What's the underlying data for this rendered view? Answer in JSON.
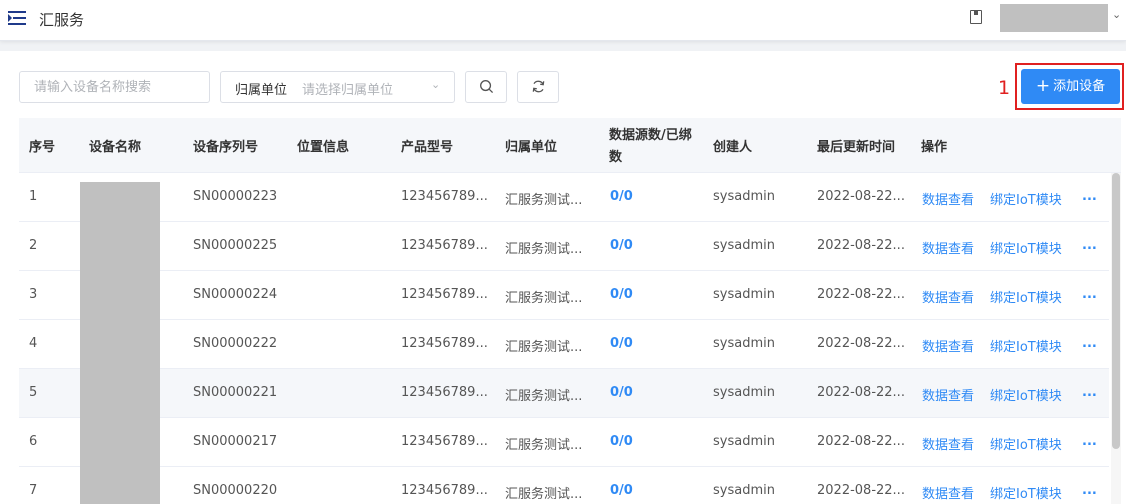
{
  "header": {
    "title": "汇服务",
    "menu_icon": "menu-fold-icon",
    "doc_icon": "document-icon",
    "user_menu_icon": "chevron-down-icon"
  },
  "toolbar": {
    "search_placeholder": "请输入设备名称搜索",
    "filter_label": "归属单位",
    "filter_placeholder": "请选择归属单位",
    "search_icon": "search-icon",
    "refresh_icon": "refresh-icon",
    "add_button_label": "添加设备",
    "add_button_icon": "plus-icon",
    "annotation_number": "1",
    "accent_color": "#2f8af5",
    "annotation_color": "#e02020"
  },
  "table": {
    "columns": [
      "序号",
      "设备名称",
      "设备序列号",
      "位置信息",
      "产品型号",
      "归属单位",
      "数据源数/已绑数",
      "创建人",
      "最后更新时间",
      "操作"
    ],
    "rows": [
      {
        "index": "1",
        "serial": "SN00000223",
        "model": "123456789...",
        "unit": "汇服务测试...",
        "count": "0/0",
        "creator": "sysadmin",
        "updated": "2022-08-22...",
        "action1": "数据查看",
        "action2": "绑定IoT模块",
        "more": "..."
      },
      {
        "index": "2",
        "serial": "SN00000225",
        "model": "123456789...",
        "unit": "汇服务测试...",
        "count": "0/0",
        "creator": "sysadmin",
        "updated": "2022-08-22...",
        "action1": "数据查看",
        "action2": "绑定IoT模块",
        "more": "..."
      },
      {
        "index": "3",
        "serial": "SN00000224",
        "model": "123456789...",
        "unit": "汇服务测试...",
        "count": "0/0",
        "creator": "sysadmin",
        "updated": "2022-08-22...",
        "action1": "数据查看",
        "action2": "绑定IoT模块",
        "more": "..."
      },
      {
        "index": "4",
        "serial": "SN00000222",
        "model": "123456789...",
        "unit": "汇服务测试...",
        "count": "0/0",
        "creator": "sysadmin",
        "updated": "2022-08-22...",
        "action1": "数据查看",
        "action2": "绑定IoT模块",
        "more": "..."
      },
      {
        "index": "5",
        "serial": "SN00000221",
        "model": "123456789...",
        "unit": "汇服务测试...",
        "count": "0/0",
        "creator": "sysadmin",
        "updated": "2022-08-22...",
        "action1": "数据查看",
        "action2": "绑定IoT模块",
        "more": "..."
      },
      {
        "index": "6",
        "serial": "SN00000217",
        "model": "123456789...",
        "unit": "汇服务测试...",
        "count": "0/0",
        "creator": "sysadmin",
        "updated": "2022-08-22...",
        "action1": "数据查看",
        "action2": "绑定IoT模块",
        "more": "..."
      },
      {
        "index": "7",
        "serial": "SN00000220",
        "model": "123456789...",
        "unit": "汇服务测试...",
        "count": "0/0",
        "creator": "sysadmin",
        "updated": "2022-08-22...",
        "action1": "数据查看",
        "action2": "绑定IoT模块",
        "more": "..."
      }
    ]
  }
}
